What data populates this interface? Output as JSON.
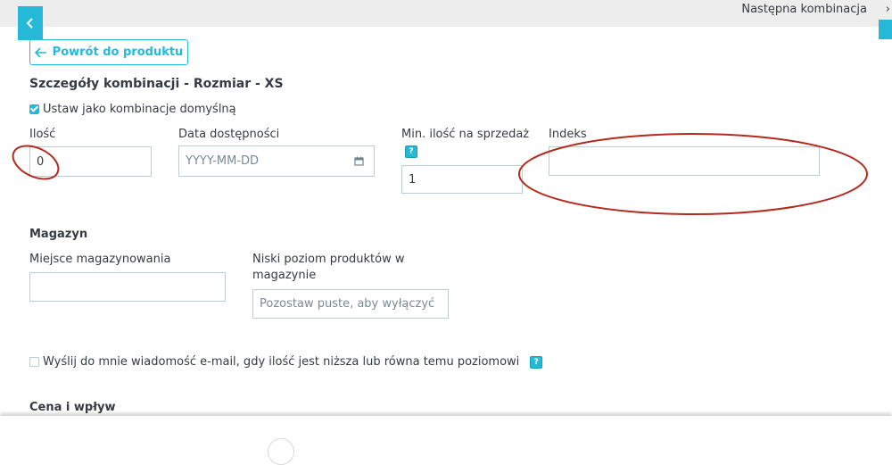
{
  "header": {
    "next_combination_label": "Następna kombinacja",
    "next_icon": "chevron-right-icon",
    "collapse_icon": "chevron-left-icon"
  },
  "back_button": {
    "label": "Powrót do produktu",
    "icon": "arrow-left-icon"
  },
  "title": "Szczegóły kombinacji - Rozmiar - XS",
  "default_checkbox": {
    "label": "Ustaw jako kombinacje domyślną",
    "checked": true
  },
  "fields": {
    "quantity": {
      "label": "Ilość",
      "value": "0"
    },
    "availability_date": {
      "label": "Data dostępności",
      "placeholder": "YYYY-MM-DD"
    },
    "min_quantity": {
      "label": "Min. ilość na sprzedaż",
      "value": "1",
      "help": "?"
    },
    "reference": {
      "label": "Indeks",
      "value": ""
    }
  },
  "stock": {
    "heading": "Magazyn",
    "location": {
      "label": "Miejsce magazynowania",
      "value": ""
    },
    "low_stock": {
      "label_line1": "Niski poziom produktów w",
      "label_line2": "magazynie",
      "placeholder": "Pozostaw puste, aby wyłączyć"
    },
    "email_alert": {
      "label": "Wyślij do mnie wiadomość e-mail, gdy ilość jest niższa lub równa temu poziomowi",
      "checked": false,
      "help": "?"
    }
  },
  "price_section": {
    "heading": "Cena i wpływ"
  },
  "colors": {
    "accent": "#25b9d7",
    "annotation": "#b52a1e",
    "text": "#363a41",
    "border": "#bbcdd2"
  }
}
